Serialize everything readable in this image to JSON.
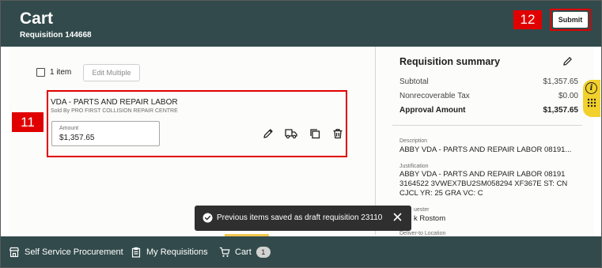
{
  "header": {
    "title": "Cart",
    "subtitle": "Requisition 144668",
    "submit_label": "Submit"
  },
  "callouts": {
    "submit": "12",
    "line": "11"
  },
  "toolbar": {
    "item_count": "1 item",
    "edit_multiple_label": "Edit Multiple"
  },
  "line": {
    "description": "VDA - PARTS AND REPAIR LABOR",
    "supplier": "Sold By PRO FIRST COLLISION REPAIR CENTRE",
    "amount_label": "Amount",
    "amount_value": "$1,357.65",
    "icons": [
      "edit-icon",
      "truck-icon",
      "copy-icon",
      "trash-icon"
    ]
  },
  "summary": {
    "title": "Requisition summary",
    "rows": [
      {
        "label": "Subtotal",
        "value": "$1,357.65"
      },
      {
        "label": "Nonrecoverable Tax",
        "value": "$0.00"
      },
      {
        "label": "Approval Amount",
        "value": "$1,357.65"
      }
    ],
    "description_label": "Description",
    "description_value": "ABBY VDA - PARTS AND REPAIR LABOR 08191...",
    "justification_label": "Justification",
    "justification_value": "ABBY VDA - PARTS AND REPAIR LABOR 08191 3164522 3VWEX7BU2SM058294 XF367E ST: CN CJCL YR: 25 GRA VC: C",
    "requester_label_partial": "uester",
    "requester_value_partial": "k Rostom",
    "deliver_label": "Deliver-to Location"
  },
  "toast": {
    "message": "Previous items saved as draft requisition 23110"
  },
  "footer": {
    "items": [
      {
        "label": "Self Service Procurement"
      },
      {
        "label": "My Requisitions"
      },
      {
        "label": "Cart",
        "badge": "1"
      }
    ]
  },
  "colors": {
    "header_bg": "#324a4b",
    "highlight": "#e00000",
    "help_bg": "#f2d12c"
  }
}
